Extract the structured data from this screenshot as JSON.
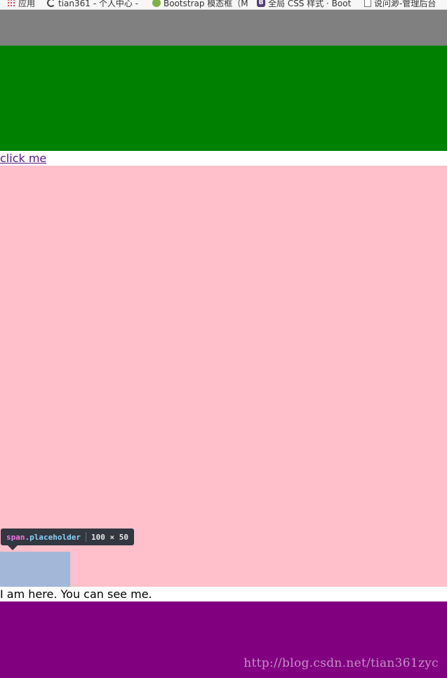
{
  "bookmarks": [
    {
      "icon": "apps-grid-icon",
      "label": "应用"
    },
    {
      "icon": "refresh-icon",
      "label": "tian361 - 个人中心 -"
    },
    {
      "icon": "leaf-icon",
      "label": "Bootstrap 模态框（M"
    },
    {
      "icon": "bootstrap-b-icon",
      "label": "全局 CSS 样式 · Boot"
    },
    {
      "icon": "page-icon",
      "label": "说问渺-管理后台"
    }
  ],
  "content": {
    "link_text": "click me",
    "message": "I am here. You can see me."
  },
  "devtools_tooltip": {
    "tag": "span",
    "class": ".placeholder",
    "size": "100 × 50"
  },
  "watermark": "http://blog.csdn.net/tian361zyc",
  "colors": {
    "gray": "#808080",
    "green": "#008000",
    "pink": "#ffc0cb",
    "placeholder": "#a3b7d9",
    "purple": "#800080",
    "link": "#551a8b"
  }
}
